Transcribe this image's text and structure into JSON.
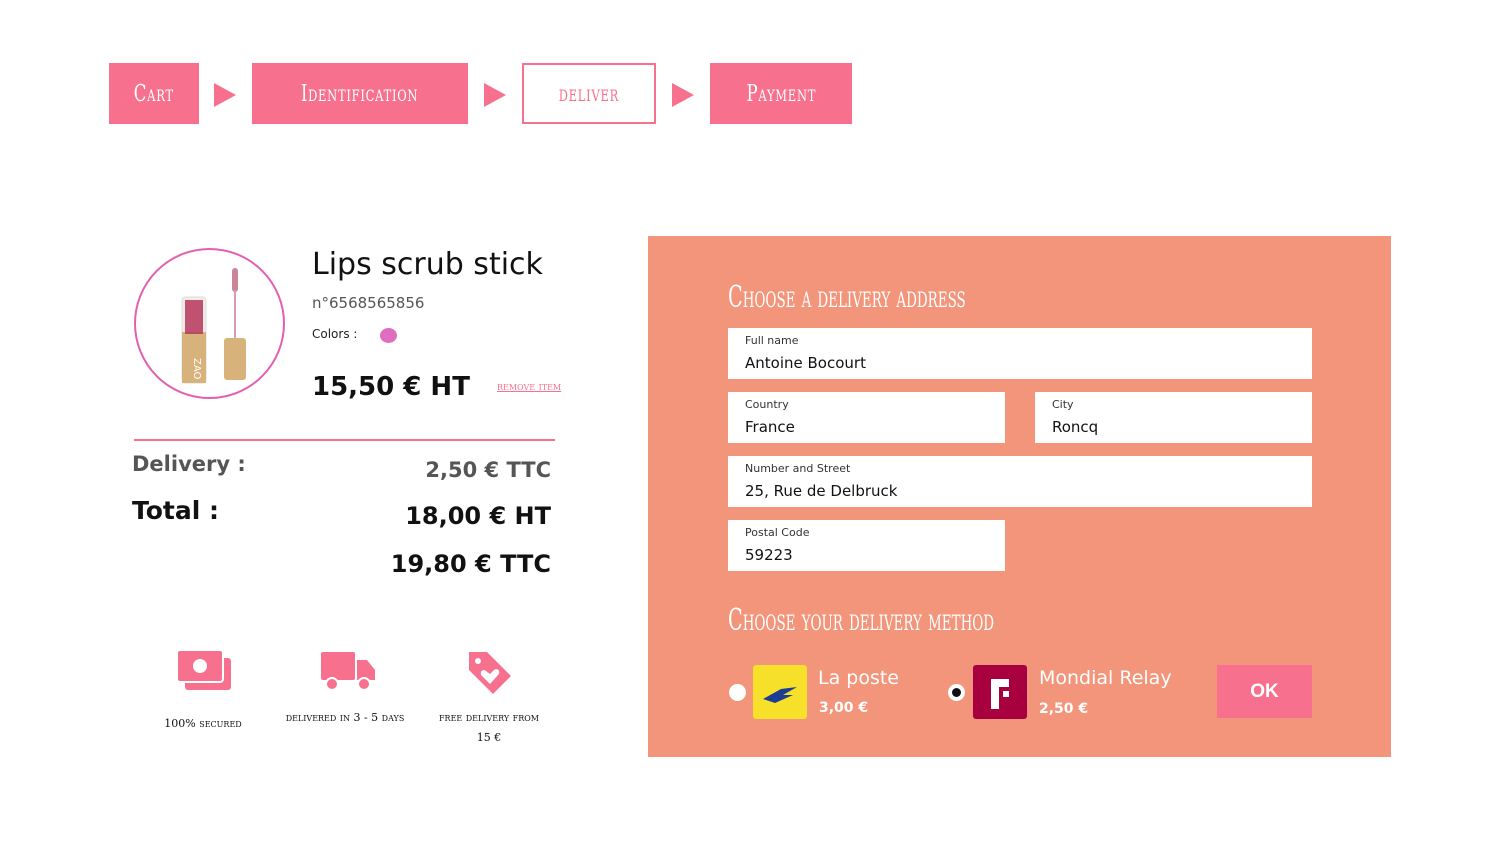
{
  "stepper": {
    "steps": [
      "Cart",
      "Identification",
      "deliver",
      "Payment"
    ],
    "active_index": 2
  },
  "product": {
    "name": "Lips scrub stick",
    "ref": "n°6568565856",
    "colors_label": "Colors :",
    "color_swatch": "#df6dc0",
    "price": "15,50 € HT",
    "remove_label": "remove item"
  },
  "summary": {
    "delivery_label": "Delivery :",
    "delivery_value": "2,50 € TTC",
    "total_label": "Total :",
    "total_ht": "18,00 € HT",
    "total_ttc": "19,80 € TTC"
  },
  "features": [
    {
      "icon": "money-icon",
      "label": "100% secured"
    },
    {
      "icon": "truck-icon",
      "label": "delivered in 3 - 5 days"
    },
    {
      "icon": "tag-heart-icon",
      "label": "free delivery from 15 €"
    }
  ],
  "address": {
    "heading": "Choose a delivery address",
    "full_name": {
      "label": "Full name",
      "value": "Antoine Bocourt"
    },
    "country": {
      "label": "Country",
      "value": "France"
    },
    "city": {
      "label": "City",
      "value": "Roncq"
    },
    "street": {
      "label": "Number and Street",
      "value": "25, Rue de Delbruck"
    },
    "postal": {
      "label": "Postal Code",
      "value": "59223"
    }
  },
  "delivery_method": {
    "heading": "Choose your delivery method",
    "options": [
      {
        "name": "La poste",
        "price": "3,00 €",
        "selected": false,
        "logo_color": "#f6e02a"
      },
      {
        "name": "Mondial Relay",
        "price": "2,50 €",
        "selected": true,
        "logo_color": "#a8003e"
      }
    ],
    "ok_label": "OK"
  },
  "colors": {
    "accent": "#f7718f",
    "panel": "#f3957a"
  }
}
